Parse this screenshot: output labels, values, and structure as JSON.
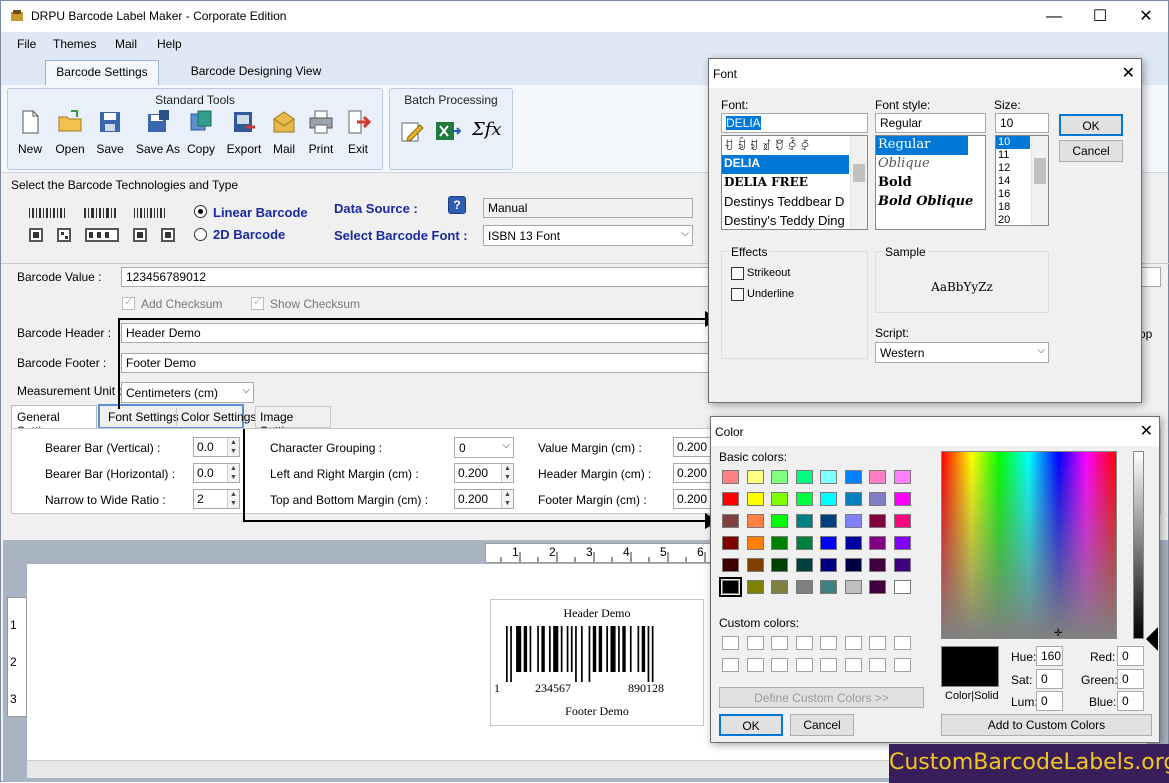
{
  "app": {
    "title": "DRPU Barcode Label Maker - Corporate Edition"
  },
  "window_controls": {
    "minimize": "—",
    "maximize": "☐",
    "close": "✕"
  },
  "menu": [
    "File",
    "Themes",
    "Mail",
    "Help"
  ],
  "tabs": [
    "Barcode Settings",
    "Barcode Designing View"
  ],
  "ribbon": {
    "standard_title": "Standard Tools",
    "standard_tools": [
      {
        "label": "New",
        "icon": "new-document-icon"
      },
      {
        "label": "Open",
        "icon": "open-folder-icon"
      },
      {
        "label": "Save",
        "icon": "save-icon"
      },
      {
        "label": "Save As",
        "icon": "save-as-icon"
      },
      {
        "label": "Copy",
        "icon": "copy-icon"
      },
      {
        "label": "Export",
        "icon": "export-icon"
      },
      {
        "label": "Mail",
        "icon": "mail-icon"
      },
      {
        "label": "Print",
        "icon": "print-icon"
      },
      {
        "label": "Exit",
        "icon": "exit-icon"
      }
    ],
    "batch_title": "Batch Processing",
    "batch_tools": [
      "edit-icon",
      "excel-icon",
      "formula-icon"
    ],
    "formula_text": "Σfx"
  },
  "tech": {
    "title": "Select the Barcode Technologies and Type",
    "linear": "Linear Barcode",
    "twod": "2D Barcode",
    "data_source_label": "Data Source :",
    "data_source_value": "Manual",
    "help": "?",
    "font_label": "Select Barcode Font :",
    "font_value": "ISBN 13 Font"
  },
  "form": {
    "barcode_value_label": "Barcode Value :",
    "barcode_value": "123456789012",
    "add_checksum": "Add Checksum",
    "show_checksum": "Show Checksum",
    "header_label": "Barcode Header :",
    "header_value": "Header Demo",
    "footer_label": "Barcode Footer :",
    "footer_value": "Footer Demo",
    "unit_label": "Measurement Unit :",
    "unit_value": "Centimeters (cm)",
    "right_cut_text": "op"
  },
  "subtabs": [
    "General Settings",
    "Font Settings",
    "Color Settings",
    "Image Settings"
  ],
  "general": {
    "bearer_v_label": "Bearer Bar (Vertical) :",
    "bearer_v": "0.0",
    "bearer_h_label": "Bearer Bar (Horizontal) :",
    "bearer_h": "0.0",
    "ratio_label": "Narrow to Wide Ratio :",
    "ratio": "2",
    "grouping_label": "Character Grouping  :",
    "grouping": "0",
    "lr_margin_label": "Left and Right Margin (cm) :",
    "lr_margin": "0.200",
    "tb_margin_label": "Top and Bottom Margin (cm) :",
    "tb_margin": "0.200",
    "value_margin_label": "Value Margin (cm) :",
    "value_margin": "0.200",
    "header_margin_label": "Header Margin (cm) :",
    "header_margin": "0.200",
    "footer_margin_label": "Footer Margin (cm) :",
    "footer_margin": "0.200"
  },
  "ruler": {
    "top": [
      "1",
      "2",
      "3",
      "4",
      "5",
      "6"
    ],
    "left": [
      "1",
      "2",
      "3"
    ]
  },
  "preview": {
    "header": "Header Demo",
    "footer": "Footer Demo",
    "d1": "1",
    "d2": "234567",
    "d3": "890128"
  },
  "font_dialog": {
    "title": "Font",
    "font_label": "Font:",
    "font_value": "DELIA",
    "fonts": [
      "ꀀ ꀁ ꀂ ꀃ ꀄ ꀅ ꀆ",
      "DELIA",
      "DELIA FREE",
      "Destinys Teddbear D",
      "Destiny's Teddy Ding"
    ],
    "style_label": "Font style:",
    "style_value": "Regular",
    "styles": [
      "Regular",
      "Oblique",
      "Bold",
      "Bold Oblique"
    ],
    "size_label": "Size:",
    "size_value": "10",
    "sizes": [
      "10",
      "11",
      "12",
      "14",
      "16",
      "18",
      "20"
    ],
    "ok": "OK",
    "cancel": "Cancel",
    "effects": "Effects",
    "strikeout": "Strikeout",
    "underline": "Underline",
    "sample": "Sample",
    "sample_text": "AaBbYyZz",
    "script_label": "Script:",
    "script_value": "Western"
  },
  "color_dialog": {
    "title": "Color",
    "basic_label": "Basic colors:",
    "basic_colors": [
      "#ff8080",
      "#ffff80",
      "#80ff80",
      "#00ff80",
      "#80ffff",
      "#0080ff",
      "#ff80c0",
      "#ff80ff",
      "#ff0000",
      "#ffff00",
      "#80ff00",
      "#00ff40",
      "#00ffff",
      "#0080c0",
      "#8080c0",
      "#ff00ff",
      "#804040",
      "#ff8040",
      "#00ff00",
      "#008080",
      "#004080",
      "#8080ff",
      "#800040",
      "#ff0080",
      "#800000",
      "#ff8000",
      "#008000",
      "#008040",
      "#0000ff",
      "#0000a0",
      "#800080",
      "#8000ff",
      "#400000",
      "#804000",
      "#004000",
      "#004040",
      "#000080",
      "#000040",
      "#400040",
      "#400080",
      "#000000",
      "#808000",
      "#808040",
      "#808080",
      "#408080",
      "#c0c0c0",
      "#400040",
      "#ffffff"
    ],
    "custom_label": "Custom colors:",
    "define_btn": "Define Custom Colors >>",
    "ok": "OK",
    "cancel": "Cancel",
    "color_solid": "Color|Solid",
    "hue_label": "Hue:",
    "hue": "160",
    "sat_label": "Sat:",
    "sat": "0",
    "lum_label": "Lum:",
    "lum": "0",
    "red_label": "Red:",
    "red": "0",
    "green_label": "Green:",
    "green": "0",
    "blue_label": "Blue:",
    "blue": "0",
    "add_btn": "Add to Custom Colors"
  },
  "watermark": "CustomBarcodeLabels.org"
}
